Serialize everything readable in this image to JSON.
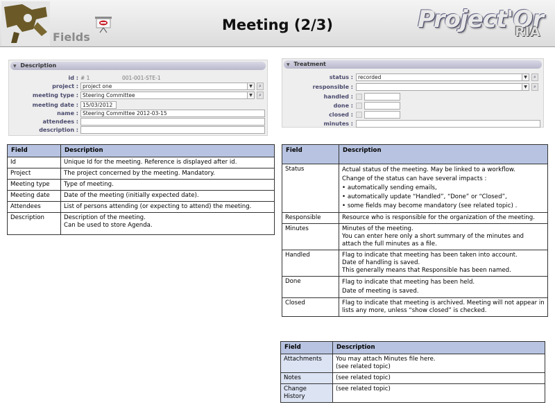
{
  "header": {
    "section_label": "Fields",
    "title": "Meeting (2/3)",
    "brand": "Project'Or",
    "brand_suffix": "RIA"
  },
  "description_panel": {
    "title": "Description",
    "fields": [
      {
        "label": "id :",
        "kind": "text",
        "values": [
          "# 1",
          "001-001-STE-1"
        ]
      },
      {
        "label": "project :",
        "kind": "combo",
        "value": "project one"
      },
      {
        "label": "meeting type :",
        "kind": "combo",
        "value": "Steering Committee"
      },
      {
        "label": "meeting date :",
        "kind": "date",
        "value": "15/03/2012"
      },
      {
        "label": "name :",
        "kind": "input",
        "value": "Steering Committee 2012-03-15"
      },
      {
        "label": "attendees :",
        "kind": "input",
        "value": ""
      },
      {
        "label": "description :",
        "kind": "input",
        "value": ""
      }
    ]
  },
  "treatment_panel": {
    "title": "Treatment",
    "fields": [
      {
        "label": "status :",
        "kind": "combo",
        "value": "recorded"
      },
      {
        "label": "responsible :",
        "kind": "combo",
        "value": ""
      },
      {
        "label": "handled :",
        "kind": "check",
        "value": ""
      },
      {
        "label": "done :",
        "kind": "check",
        "value": ""
      },
      {
        "label": "closed :",
        "kind": "check",
        "value": ""
      },
      {
        "label": "minutes :",
        "kind": "input",
        "value": ""
      }
    ]
  },
  "table_left": {
    "headers": [
      "Field",
      "Description"
    ],
    "rows": [
      {
        "field": "Id",
        "desc": [
          "Unique Id for the meeting. Reference is displayed after id."
        ]
      },
      {
        "field": "Project",
        "desc": [
          "The project concerned by the meeting. Mandatory."
        ]
      },
      {
        "field": "Meeting type",
        "desc": [
          "Type of meeting."
        ]
      },
      {
        "field": "Meeting date",
        "desc": [
          "Date of the meeting (initially expected date)."
        ]
      },
      {
        "field": "Attendees",
        "desc": [
          "List of persons attending (or expecting to attend) the meeting."
        ]
      },
      {
        "field": "Description",
        "desc": [
          "Description of the meeting.",
          "Can be used to store Agenda."
        ]
      }
    ]
  },
  "table_right": {
    "headers": [
      "Field",
      "Description"
    ],
    "rows": [
      {
        "field": "Status",
        "desc": [
          "Actual status of the meeting. May be linked to a workflow.",
          "Change of the status can have several impacts :"
        ],
        "bullets": [
          "automatically sending emails,",
          "automatically update “Handled”, “Done” or “Closed”,",
          "some fields may become mandatory (see related topic) ."
        ]
      },
      {
        "field": "Responsible",
        "desc": [
          "Resource who is responsible for the organization of the meeting."
        ]
      },
      {
        "field": "Minutes",
        "desc": [
          "Minutes of the meeting.",
          "You can enter here only a short summary of the minutes and attach the full minutes as a file."
        ]
      },
      {
        "field": "Handled",
        "desc": [
          "Flag to indicate that meeting has been taken into account.",
          "Date of handling is saved.",
          "This generally means that Responsible has been named."
        ]
      },
      {
        "field": "Done",
        "desc": [
          "Flag to indicate that meeting has been held.",
          "Date of meeting is saved."
        ]
      },
      {
        "field": "Closed",
        "desc": [
          "Flag to indicate that meeting is archived. Meeting will not appear in lists any more, unless “show closed” is checked."
        ]
      }
    ]
  },
  "table_bottom": {
    "headers": [
      "Field",
      "Description"
    ],
    "rows": [
      {
        "field": "Attachments",
        "desc": [
          "You may attach Minutes file here.",
          "(see related topic)"
        ]
      },
      {
        "field": "Notes",
        "desc": [
          "(see related topic)"
        ]
      },
      {
        "field": "Change History",
        "desc": [
          "(see related topic)"
        ]
      }
    ]
  }
}
